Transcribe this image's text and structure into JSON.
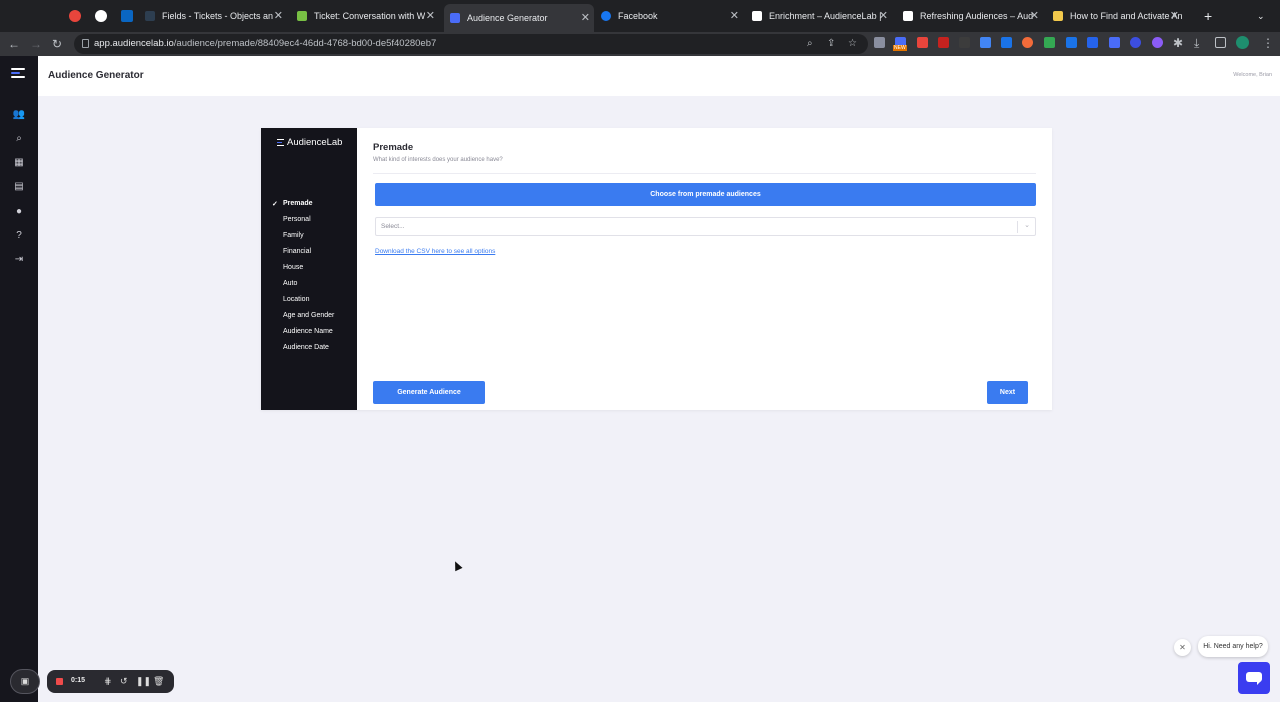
{
  "browser": {
    "tabs": [
      {
        "label": "",
        "icon": "recording-icon",
        "color": "#e8453c"
      },
      {
        "label": "",
        "icon": "google-icon",
        "color": "#4285f4"
      },
      {
        "label": "",
        "icon": "linkedin-icon",
        "color": "#0a66c2"
      },
      {
        "label": "Fields - Tickets - Objects an",
        "icon": "hubspot-icon",
        "color": "#2d3e50"
      },
      {
        "label": "Ticket: Conversation with W",
        "icon": "zendesk-icon",
        "color": "#78c044"
      },
      {
        "label": "Audience Generator",
        "icon": "audiencelab-icon",
        "color": "#4a6cf7"
      },
      {
        "label": "Facebook",
        "icon": "facebook-icon",
        "color": "#1877f2"
      },
      {
        "label": "Enrichment – AudienceLab |",
        "icon": "audiencelab-icon",
        "color": "#ffffff"
      },
      {
        "label": "Refreshing Audiences – Aud",
        "icon": "audiencelab-icon",
        "color": "#ffffff"
      },
      {
        "label": "How to Find and Activate An",
        "icon": "doc-icon",
        "color": "#f2c94c"
      }
    ],
    "url_domain": "app.audiencelab.io",
    "url_path": "/audience/premade/88409ec4-46dd-4768-bd00-de5f40280eb7",
    "extension_badge": "NEW"
  },
  "app": {
    "page_title": "Audience Generator",
    "welcome_text": "Welcome, Brian",
    "rail_icons": [
      "users-icon",
      "search-icon",
      "map-icon",
      "building-icon",
      "user-icon",
      "help-icon",
      "logout-icon"
    ]
  },
  "wizard": {
    "brand": "AudienceLab",
    "steps": [
      "Premade",
      "Personal",
      "Family",
      "Financial",
      "House",
      "Auto",
      "Location",
      "Age and Gender",
      "Audience Name",
      "Audience Date"
    ],
    "active_step": "Premade",
    "section_title": "Premade",
    "section_subtitle": "What kind of interests does your audience have?",
    "choose_button": "Choose from premade audiences",
    "select_placeholder": "Select...",
    "csv_link": "Download the CSV here to see all options",
    "generate_button": "Generate Audience",
    "next_button": "Next"
  },
  "recorder": {
    "time": "0:15"
  },
  "help": {
    "bubble_text": "Hi. Need any help?"
  },
  "colors": {
    "accent": "#3a7bf0",
    "sidebar": "#14141b",
    "background": "#f1f1f8"
  }
}
